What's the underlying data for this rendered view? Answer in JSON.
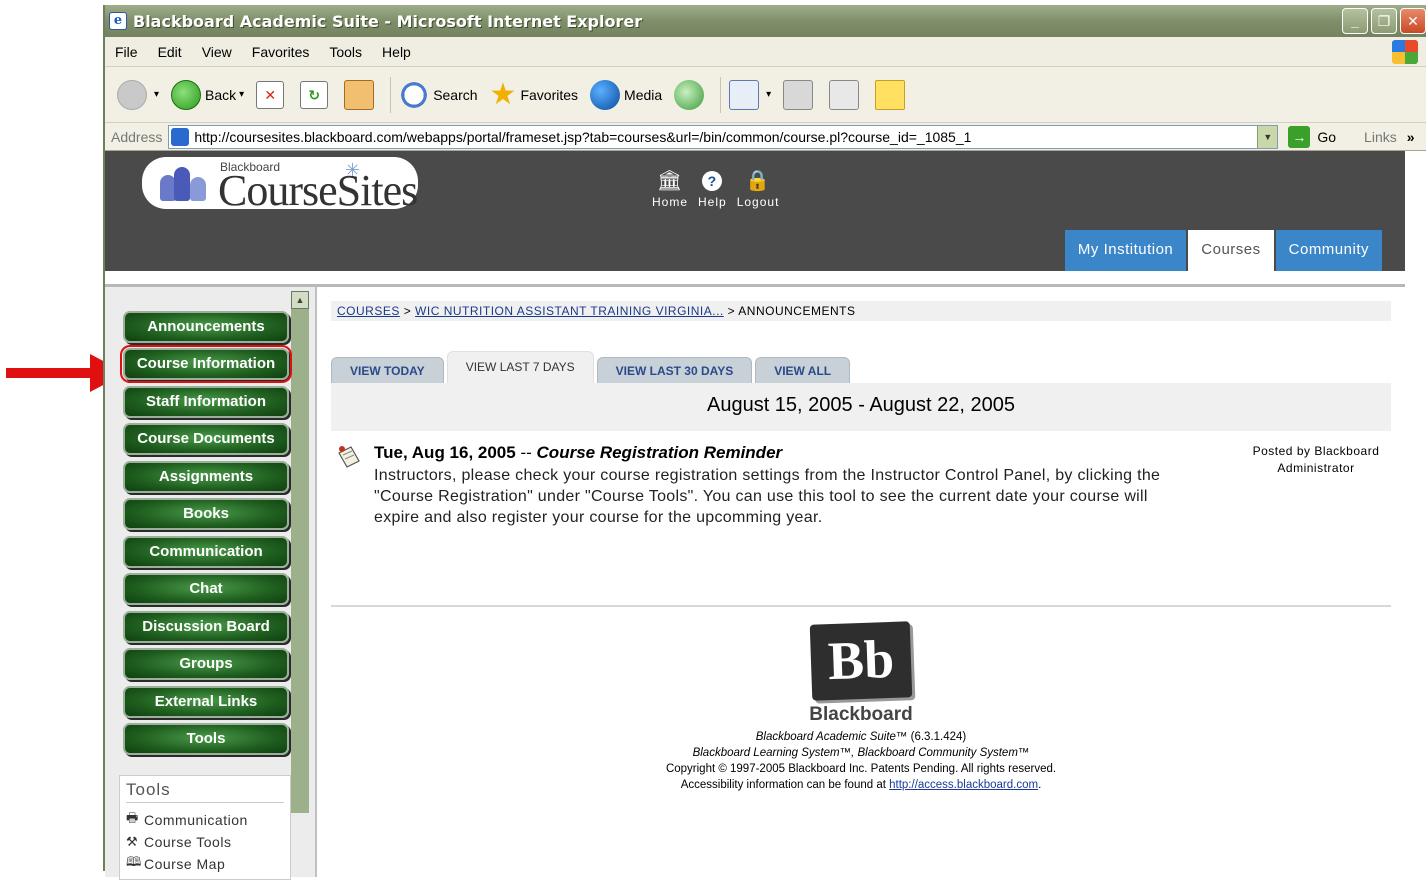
{
  "window": {
    "title": "Blackboard Academic Suite - Microsoft Internet Explorer",
    "controls": [
      "_",
      "❐",
      "✕"
    ]
  },
  "menubar": [
    "File",
    "Edit",
    "View",
    "Favorites",
    "Tools",
    "Help"
  ],
  "toolbar": {
    "back_label": "Back",
    "search_label": "Search",
    "favorites_label": "Favorites",
    "media_label": "Media"
  },
  "addressbar": {
    "label": "Address",
    "url": "http://coursesites.blackboard.com/webapps/portal/frameset.jsp?tab=courses&url=/bin/common/course.pl?course_id=_1085_1",
    "go_label": "Go",
    "links_label": "Links"
  },
  "header": {
    "logo_small": "Blackboard",
    "logo_big": "CourseSites",
    "top_nav": [
      {
        "label": "Home",
        "icon": "institution-icon"
      },
      {
        "label": "Help",
        "icon": "help-icon"
      },
      {
        "label": "Logout",
        "icon": "lock-icon"
      }
    ],
    "tabs": [
      {
        "label": "My Institution",
        "active": false
      },
      {
        "label": "Courses",
        "active": true
      },
      {
        "label": "Community",
        "active": false
      }
    ]
  },
  "course_menu": {
    "buttons": [
      "Announcements",
      "Course Information",
      "Staff Information",
      "Course Documents",
      "Assignments",
      "Books",
      "Communication",
      "Chat",
      "Discussion Board",
      "Groups",
      "External Links",
      "Tools"
    ],
    "highlighted": "Course Information",
    "tools_box": {
      "title": "Tools",
      "items": [
        {
          "label": "Communication",
          "icon": "printer-icon"
        },
        {
          "label": "Course Tools",
          "icon": "tools-icon"
        },
        {
          "label": "Course Map",
          "icon": "book-icon"
        }
      ]
    }
  },
  "breadcrumb": {
    "items": [
      "COURSES",
      "WIC NUTRITION ASSISTANT TRAINING VIRGINIA...",
      "ANNOUNCEMENTS"
    ],
    "separator": ">"
  },
  "subtabs": [
    {
      "label": "VIEW TODAY",
      "active": false
    },
    {
      "label": "VIEW LAST 7 DAYS",
      "active": true
    },
    {
      "label": "VIEW LAST 30 DAYS",
      "active": false
    },
    {
      "label": "VIEW ALL",
      "active": false
    }
  ],
  "date_range": "August 15, 2005 - August 22, 2005",
  "announcement": {
    "date": "Tue, Aug 16, 2005",
    "separator": "--",
    "subject": "Course Registration Reminder",
    "body": "Instructors, please check your course registration settings from the Instructor Control Panel, by clicking the \"Course Registration\" under \"Course Tools\". You can use this tool to see the current date your course will expire and also register your course for the upcomming year.",
    "posted_by": "Posted by Blackboard Administrator"
  },
  "footer": {
    "logo_text": "Bb",
    "brand": "Blackboard",
    "line1_italic": "Blackboard Academic Suite™",
    "line1_rest": " (6.3.1.424)",
    "line2": "Blackboard Learning System™, Blackboard Community System™",
    "line3": "Copyright © 1997-2005 Blackboard Inc. Patents Pending. All rights reserved.",
    "line4_prefix": "Accessibility information can be found at ",
    "line4_link": "http://access.blackboard.com",
    "line4_suffix": "."
  },
  "colors": {
    "menu_green": "#1f5e1f",
    "tab_blue": "#3a86c8",
    "header_gray": "#4a4a4a",
    "arrow_red": "#e01010"
  }
}
